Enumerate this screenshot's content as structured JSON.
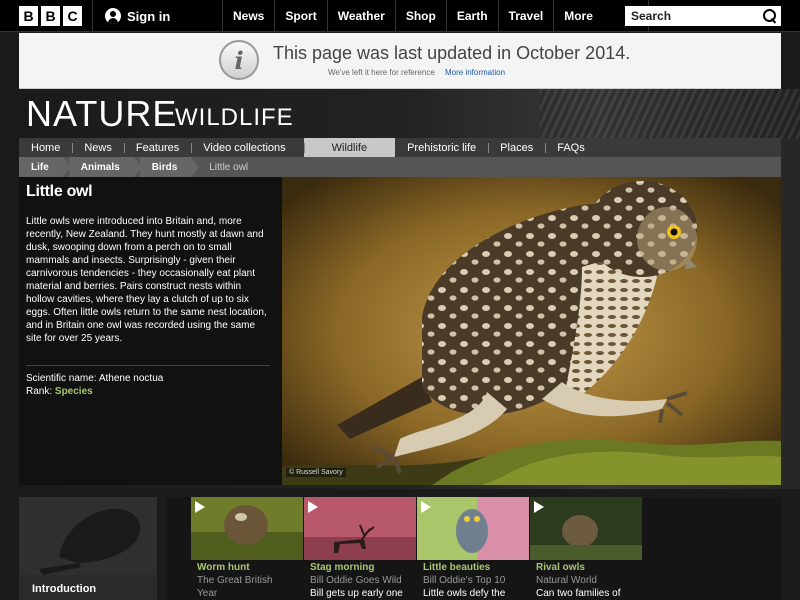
{
  "topbar": {
    "logo_letters": [
      "B",
      "B",
      "C"
    ],
    "signin_label": "Sign in",
    "nav": [
      "News",
      "Sport",
      "Weather",
      "Shop",
      "Earth",
      "Travel",
      "More"
    ],
    "search_placeholder": "Search"
  },
  "notice": {
    "icon_letter": "i",
    "title": "This page was last updated in October 2014.",
    "subtitle": "We've left it here for reference",
    "link": "More information"
  },
  "header": {
    "title": "NATURE",
    "subtitle": "WILDLIFE"
  },
  "section_nav": {
    "items": [
      "Home",
      "News",
      "Features",
      "Video collections",
      "Wildlife",
      "Prehistoric life",
      "Places",
      "FAQs"
    ],
    "active": "Wildlife"
  },
  "breadcrumb": [
    "Life",
    "Animals",
    "Birds",
    "Little owl"
  ],
  "species": {
    "name": "Little owl",
    "description": "Little owls were introduced into Britain and, more recently, New Zealand. They hunt mostly at dawn and dusk, swooping down from a perch on to small mammals and insects. Surprisingly - given their carnivorous tendencies - they occasionally eat plant material and berries. Pairs construct nests within hollow cavities, where they lay a clutch of up to six eggs. Often little owls return to the same nest location, and in Britain one owl was recorded using the same site for over 25 years.",
    "scientific_label": "Scientific name:",
    "scientific_name": "Athene noctua",
    "rank_label": "Rank:",
    "rank": "Species",
    "photo_credit": "© Russell Savory"
  },
  "intro": {
    "label": "Introduction"
  },
  "videos": [
    {
      "title": "Worm hunt",
      "source": "The Great British",
      "desc": "Year"
    },
    {
      "title": "Stag morning",
      "source": "Bill Oddie Goes Wild",
      "desc": "Bill gets up early one"
    },
    {
      "title": "Little beauties",
      "source": "Bill Oddie's Top 10",
      "desc": "Little owls defy the"
    },
    {
      "title": "Rival owls",
      "source": "Natural World",
      "desc": "Can two families of"
    }
  ],
  "colors": {
    "accent_green": "#a7c66f",
    "link_blue": "#1e5aa8",
    "active_tab": "#c8c8c8"
  }
}
